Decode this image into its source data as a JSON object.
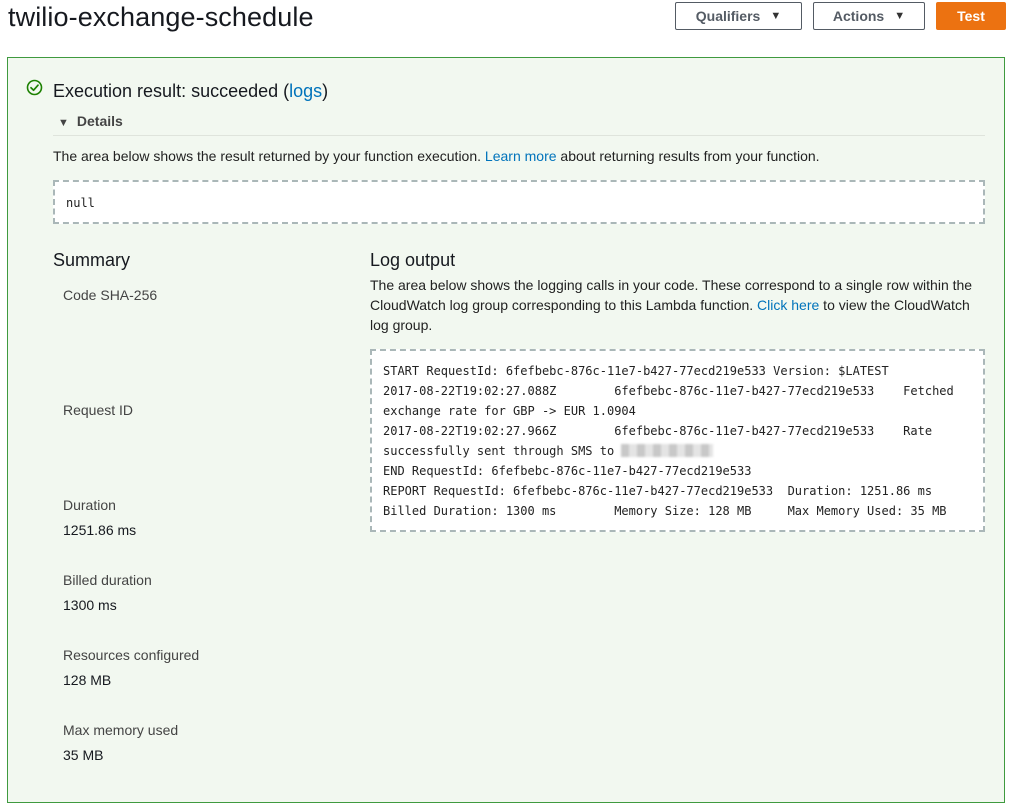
{
  "header": {
    "title": "twilio-exchange-schedule",
    "qualifiers_label": "Qualifiers",
    "actions_label": "Actions",
    "test_label": "Test"
  },
  "result": {
    "title_prefix": "Execution result: succeeded (",
    "logs_link": "logs",
    "title_suffix": ")",
    "details_label": "Details",
    "desc_before": "The area below shows the result returned by your function execution. ",
    "learn_more": "Learn more",
    "desc_after": " about returning results from your function.",
    "output": "null"
  },
  "summary": {
    "heading": "Summary",
    "code_sha_label": "Code SHA-256",
    "request_id_label": "Request ID",
    "duration_label": "Duration",
    "duration_value": "1251.86 ms",
    "billed_label": "Billed duration",
    "billed_value": "1300 ms",
    "resources_label": "Resources configured",
    "resources_value": "128 MB",
    "max_mem_label": "Max memory used",
    "max_mem_value": "35 MB"
  },
  "log": {
    "heading": "Log output",
    "desc_before": "The area below shows the logging calls in your code. These correspond to a single row within the CloudWatch log group corresponding to this Lambda function. ",
    "click_here": "Click here",
    "desc_after": " to view the CloudWatch log group.",
    "lines": {
      "l1": "START RequestId: 6fefbebc-876c-11e7-b427-77ecd219e533 Version: $LATEST",
      "l2": "2017-08-22T19:02:27.088Z        6fefbebc-876c-11e7-b427-77ecd219e533    Fetched",
      "l3": "exchange rate for GBP -> EUR 1.0904",
      "l4": "2017-08-22T19:02:27.966Z        6fefbebc-876c-11e7-b427-77ecd219e533    Rate",
      "l5": "successfully sent through SMS to ",
      "l6": "END RequestId: 6fefbebc-876c-11e7-b427-77ecd219e533",
      "l7": "REPORT RequestId: 6fefbebc-876c-11e7-b427-77ecd219e533  Duration: 1251.86 ms",
      "l8": "Billed Duration: 1300 ms        Memory Size: 128 MB     Max Memory Used: 35 MB"
    }
  },
  "colors": {
    "success_green": "#1d8102",
    "panel_border": "#3f9a3f",
    "test_orange": "#ec7211",
    "link_blue": "#0073bb"
  }
}
